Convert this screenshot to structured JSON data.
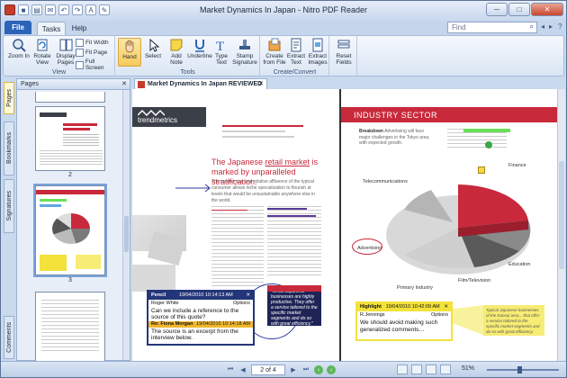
{
  "window": {
    "title": "Market Dynamics In Japan - Nitro PDF Reader",
    "minimize": "─",
    "maximize": "□",
    "close": "✕"
  },
  "tabs": {
    "file": "File",
    "tasks": "Tasks",
    "help": "Help"
  },
  "find": {
    "placeholder": "Find",
    "search_icon": "⌕"
  },
  "ribbon": {
    "view": {
      "label": "View",
      "zoom": "Zoom In",
      "rotate": "Rotate View",
      "display": "Display Pages",
      "fit_width": "Fit Width",
      "fit_page": "Fit Page",
      "full_screen": "Full Screen"
    },
    "tools": {
      "label": "Tools",
      "hand": "Hand",
      "select": "Select",
      "add_note": "Add Note",
      "underline": "Underline",
      "type_text": "Type Text",
      "stamp": "Stamp Signature"
    },
    "create": {
      "label": "Create/Convert",
      "create_file": "Create from File",
      "extract_text": "Extract Text",
      "extract_images": "Extract Images"
    },
    "reset": {
      "label": "Reset Fields",
      "text": "Reset Fields"
    }
  },
  "left_tabs": {
    "pages": "Pages",
    "bookmarks": "Bookmarks",
    "signatures": "Signatures",
    "comments": "Comments"
  },
  "pages_panel": {
    "title": "Pages",
    "close": "✕",
    "thumbs": [
      {
        "num": "2"
      },
      {
        "num": "3"
      }
    ]
  },
  "doc": {
    "tab_title": "Market Dynamics In Japan REVIEWED",
    "tab_close": "✕",
    "left_page": {
      "brand": "trendmetrics",
      "headline_pre": "The Japanese ",
      "headline_link": "retail market",
      "headline_post": " is marked by unparalleled stratification.",
      "para": "The market size and relative affluence of the typical consumer allows niche specialization to flourish at levels that would be unsustainable anywhere else in the world.",
      "pencil_note": {
        "type": "Pencil",
        "date": "19/04/2010 10:14:13 AM",
        "author": "Roger White",
        "options": "Options",
        "body": "Can we include a reference to the source of this quote?",
        "reply_author": "Re: Fiona Morgan",
        "reply_date": "19/04/2010 10:14:18 AM",
        "reply_body": "The source is an excerpt from the interview below."
      },
      "quote": "\"Small Japanese businesses are highly productive. They offer a service tailored to the specific market segments and do so with great efficiency.\""
    },
    "right_page": {
      "banner": "INDUSTRY SECTOR",
      "breakdown_label": "Breakdown",
      "breakdown": "Advertising will face major challenges in the Tokyo area, with expected growth.",
      "labels": {
        "finance": "Finance",
        "telecom": "Telecommunications",
        "advertising": "Advertising",
        "education": "Education",
        "film": "Film/Television",
        "primary": "Primary Industry"
      },
      "highlight_note": {
        "type": "Highlight",
        "date": "19/04/2010 10:42:09 AM",
        "author": "R.Jennings",
        "options": "Options",
        "body": "We should avoid making such generalized comments…"
      },
      "yellow_text": "Typical Japanese businesses of the Kansai area... that offer a service tailored to the specific market segments and do so with great efficiency."
    }
  },
  "status": {
    "page": "2 of 4",
    "zoom": "51%",
    "first": "⏮",
    "prev": "◀",
    "next": "▶",
    "last": "⏭"
  }
}
